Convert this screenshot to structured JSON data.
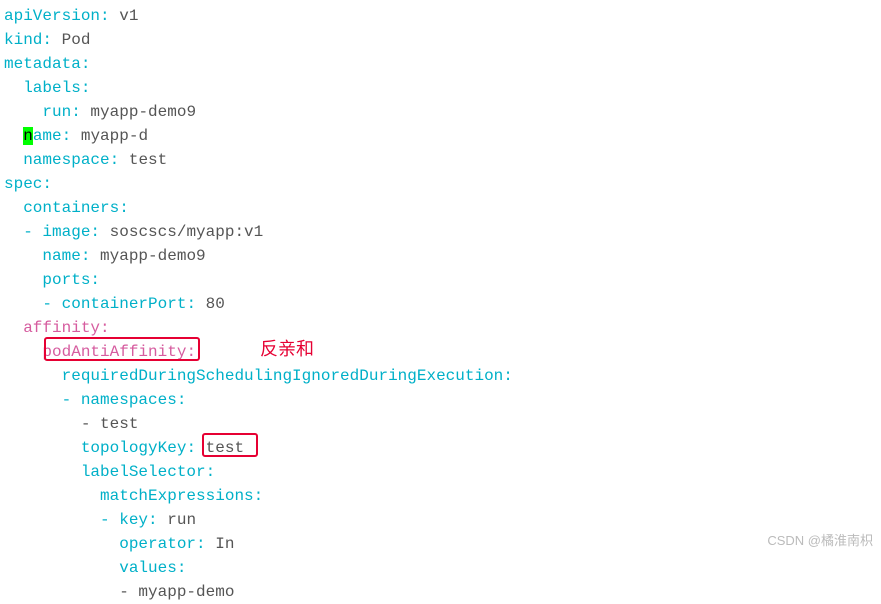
{
  "annotation": "反亲和",
  "watermark": "CSDN @橘淮南枳",
  "yaml": {
    "l1k": "apiVersion",
    "l1v": " v1",
    "l2k": "kind",
    "l2v": " Pod",
    "l3k": "metadata",
    "l4k": "  labels",
    "l5k": "    run",
    "l5v": " myapp-demo9",
    "l6pre": "  ",
    "l6n": "n",
    "l6k": "ame",
    "l6v": " myapp-d",
    "l7k": "  namespace",
    "l7v": " test",
    "l8k": "spec",
    "l9k": "  containers",
    "l10k": "  - image",
    "l10v": " soscscs/myapp:v1",
    "l11k": "    name",
    "l11v": " myapp-demo9",
    "l12k": "    ports",
    "l13k": "    - containerPort",
    "l13v": " 80",
    "l14k": "  affinity",
    "l15k": "    podAntiAffinity",
    "l16k": "      requiredDuringSchedulingIgnoredDuringExecution",
    "l17k": "      - namespaces",
    "l18v": "        - test",
    "l19k": "        topologyKey",
    "l19v": " test",
    "l20k": "        labelSelector",
    "l21k": "          matchExpressions",
    "l22k": "          - key",
    "l22v": " run",
    "l23k": "            operator",
    "l23v": " In",
    "l24k": "            values",
    "l25v": "            - myapp-demo"
  }
}
